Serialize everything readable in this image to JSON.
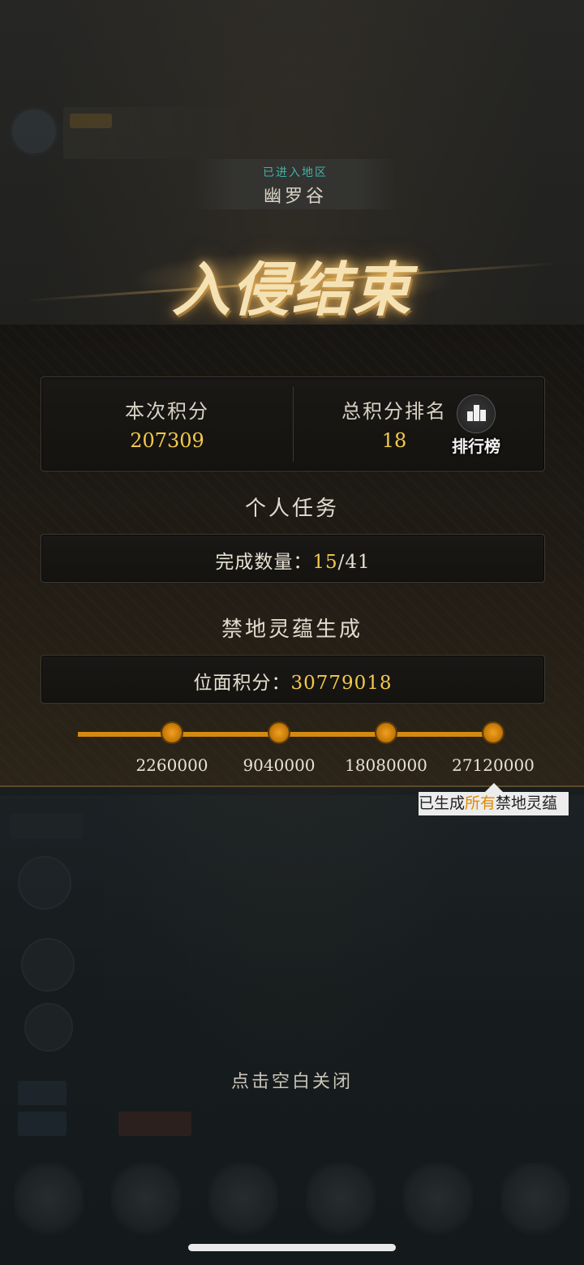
{
  "region": {
    "entered_label": "已进入地区",
    "name": "幽罗谷"
  },
  "title": "入侵结束",
  "score": {
    "current_label": "本次积分",
    "current_value": "207309",
    "rank_label": "总积分排名",
    "rank_value": "18",
    "leaderboard_button": "排行榜"
  },
  "personal_tasks": {
    "section_title": "个人任务",
    "completed_label": "完成数量：",
    "completed_value": "15",
    "total_value": "/41"
  },
  "forbidden_land": {
    "section_title": "禁地灵蕴生成",
    "plane_score_label": "位面积分：",
    "plane_score_value": "30779018",
    "milestones": [
      "2260000",
      "9040000",
      "18080000",
      "27120000"
    ],
    "tooltip_part1": "已生成",
    "tooltip_part2": "所有",
    "tooltip_part3": "禁地灵蕴"
  },
  "close_hint": "点击空白关闭",
  "colors": {
    "accent_gold": "#f2c94c",
    "progress_orange": "#d38a10",
    "region_teal": "#3fb3a6"
  },
  "icons": {
    "leaderboard": "bar-chart-icon"
  }
}
